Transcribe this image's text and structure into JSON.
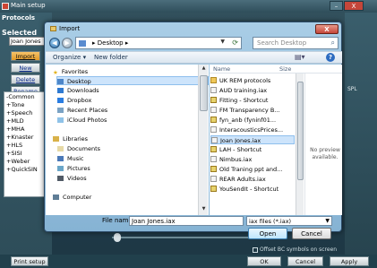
{
  "main_window": {
    "title": "Main setup",
    "protocols_header": "Protocols",
    "selected_header": "Selected",
    "patient_name": "Joan Jones",
    "buttons": {
      "import": "Import",
      "new": "New",
      "delete": "Delete",
      "rename": "Rename"
    },
    "protocol_tree": [
      "Common",
      "Tone",
      "Speech",
      "MLD",
      "MHA",
      "Knaster",
      "HLS",
      "SISI",
      "Weber",
      "QuickSIN"
    ],
    "spl_label": "SPL",
    "offset_label": "Offset BC symbols on screen",
    "footer": {
      "print_setup": "Print setup",
      "ok": "OK",
      "cancel": "Cancel",
      "apply": "Apply"
    },
    "window_close": "X"
  },
  "dialog": {
    "title": "Import",
    "close_label": "X",
    "address": "Desktop",
    "search_placeholder": "Search Desktop",
    "toolbar": {
      "organize": "Organize ▾",
      "new_folder": "New folder"
    },
    "nav_items": [
      {
        "label": "Favorites",
        "icon": "star-icon"
      },
      {
        "label": "Desktop",
        "icon": "desktop-icon"
      },
      {
        "label": "Downloads",
        "icon": "downloads-icon"
      },
      {
        "label": "Dropbox",
        "icon": "dropbox-icon"
      },
      {
        "label": "Recent Places",
        "icon": "recent-icon"
      },
      {
        "label": "iCloud Photos",
        "icon": "cloud-icon"
      },
      {
        "label": "Libraries",
        "icon": "library-icon"
      },
      {
        "label": "Documents",
        "icon": "documents-icon"
      },
      {
        "label": "Music",
        "icon": "music-icon"
      },
      {
        "label": "Pictures",
        "icon": "pictures-icon"
      },
      {
        "label": "Videos",
        "icon": "videos-icon"
      },
      {
        "label": "Computer",
        "icon": "computer-icon"
      }
    ],
    "columns": {
      "name": "Name",
      "size": "Size"
    },
    "files": [
      {
        "name": "UK REM protocols",
        "type": "folder"
      },
      {
        "name": "AUD training.iax",
        "type": "file"
      },
      {
        "name": "Fitting - Shortcut",
        "type": "shortcut"
      },
      {
        "name": "FM Transparency B...",
        "type": "file"
      },
      {
        "name": "fyn_anb (fyninf01...",
        "type": "shortcut"
      },
      {
        "name": "InteracousticsPrices...",
        "type": "file"
      },
      {
        "name": "Joan Jones.iax",
        "type": "file"
      },
      {
        "name": "LAH - Shortcut",
        "type": "shortcut"
      },
      {
        "name": "Nimbus.iax",
        "type": "file"
      },
      {
        "name": "Old Traning ppt and...",
        "type": "shortcut"
      },
      {
        "name": "REAR Adults.iax",
        "type": "file"
      },
      {
        "name": "YouSendIt - Shortcut",
        "type": "shortcut"
      }
    ],
    "selected_file_index": 6,
    "preview_text": "No preview available.",
    "file_name_label": "File name:",
    "file_name_value": "Joan Jones.iax",
    "file_type_value": "iax files (*.iax)",
    "open_label": "Open",
    "cancel_label": "Cancel"
  }
}
